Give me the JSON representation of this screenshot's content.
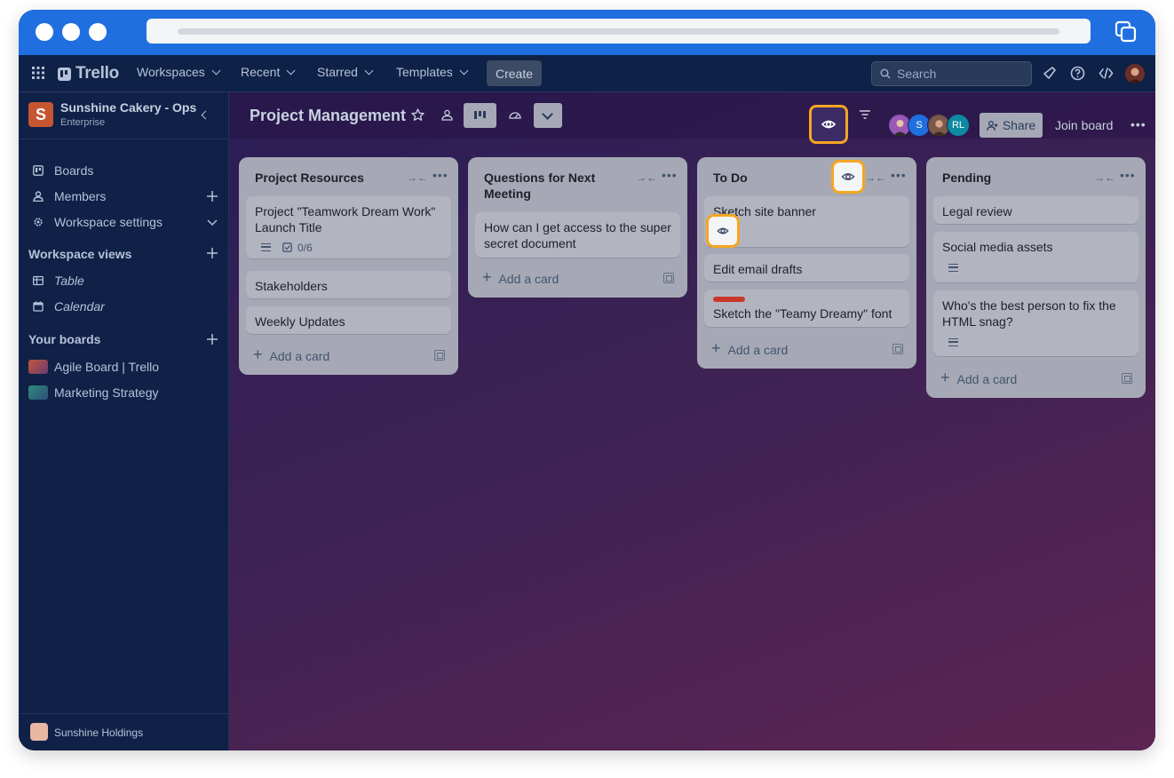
{
  "nav": {
    "logo": "Trello",
    "menus": [
      "Workspaces",
      "Recent",
      "Starred",
      "Templates"
    ],
    "create_label": "Create",
    "search_placeholder": "Search"
  },
  "sidebar": {
    "workspace_name": "Sunshine Cakery - Ops",
    "workspace_plan": "Enterprise",
    "workspace_initial": "S",
    "items": [
      {
        "label": "Boards"
      },
      {
        "label": "Members"
      },
      {
        "label": "Workspace settings"
      }
    ],
    "views_heading": "Workspace views",
    "views": [
      {
        "label": "Table"
      },
      {
        "label": "Calendar"
      }
    ],
    "boards_heading": "Your boards",
    "boards": [
      {
        "label": "Agile Board | Trello"
      },
      {
        "label": "Marketing Strategy"
      }
    ],
    "footer_label": "Sunshine Holdings"
  },
  "board": {
    "title": "Project Management",
    "share_label": "Share",
    "join_label": "Join board",
    "avatar_labels": [
      "S",
      "RL"
    ]
  },
  "lists": [
    {
      "title": "Project Resources",
      "cards": [
        {
          "text": "Project \"Teamwork Dream Work\" Launch Title",
          "checklist": "0/6"
        },
        {
          "text": "Stakeholders"
        },
        {
          "text": "Weekly Updates"
        }
      ],
      "add_label": "Add a card"
    },
    {
      "title": "Questions for Next Meeting",
      "cards": [
        {
          "text": "How can I get access to the super secret document"
        }
      ],
      "add_label": "Add a card"
    },
    {
      "title": "To Do",
      "cards": [
        {
          "text": "Sketch site banner"
        },
        {
          "text": "Edit email drafts"
        },
        {
          "text": "Sketch the \"Teamy Dreamy\" font"
        }
      ],
      "add_label": "Add a card"
    },
    {
      "title": "Pending",
      "cards": [
        {
          "text": "Legal review"
        },
        {
          "text": "Social media assets"
        },
        {
          "text": "Who's the best person to fix the HTML snag?"
        }
      ],
      "add_label": "Add a card"
    }
  ],
  "colors": {
    "highlight": "#f5a623",
    "chrome": "#1f6fe0",
    "label_red": "#c9372c"
  }
}
